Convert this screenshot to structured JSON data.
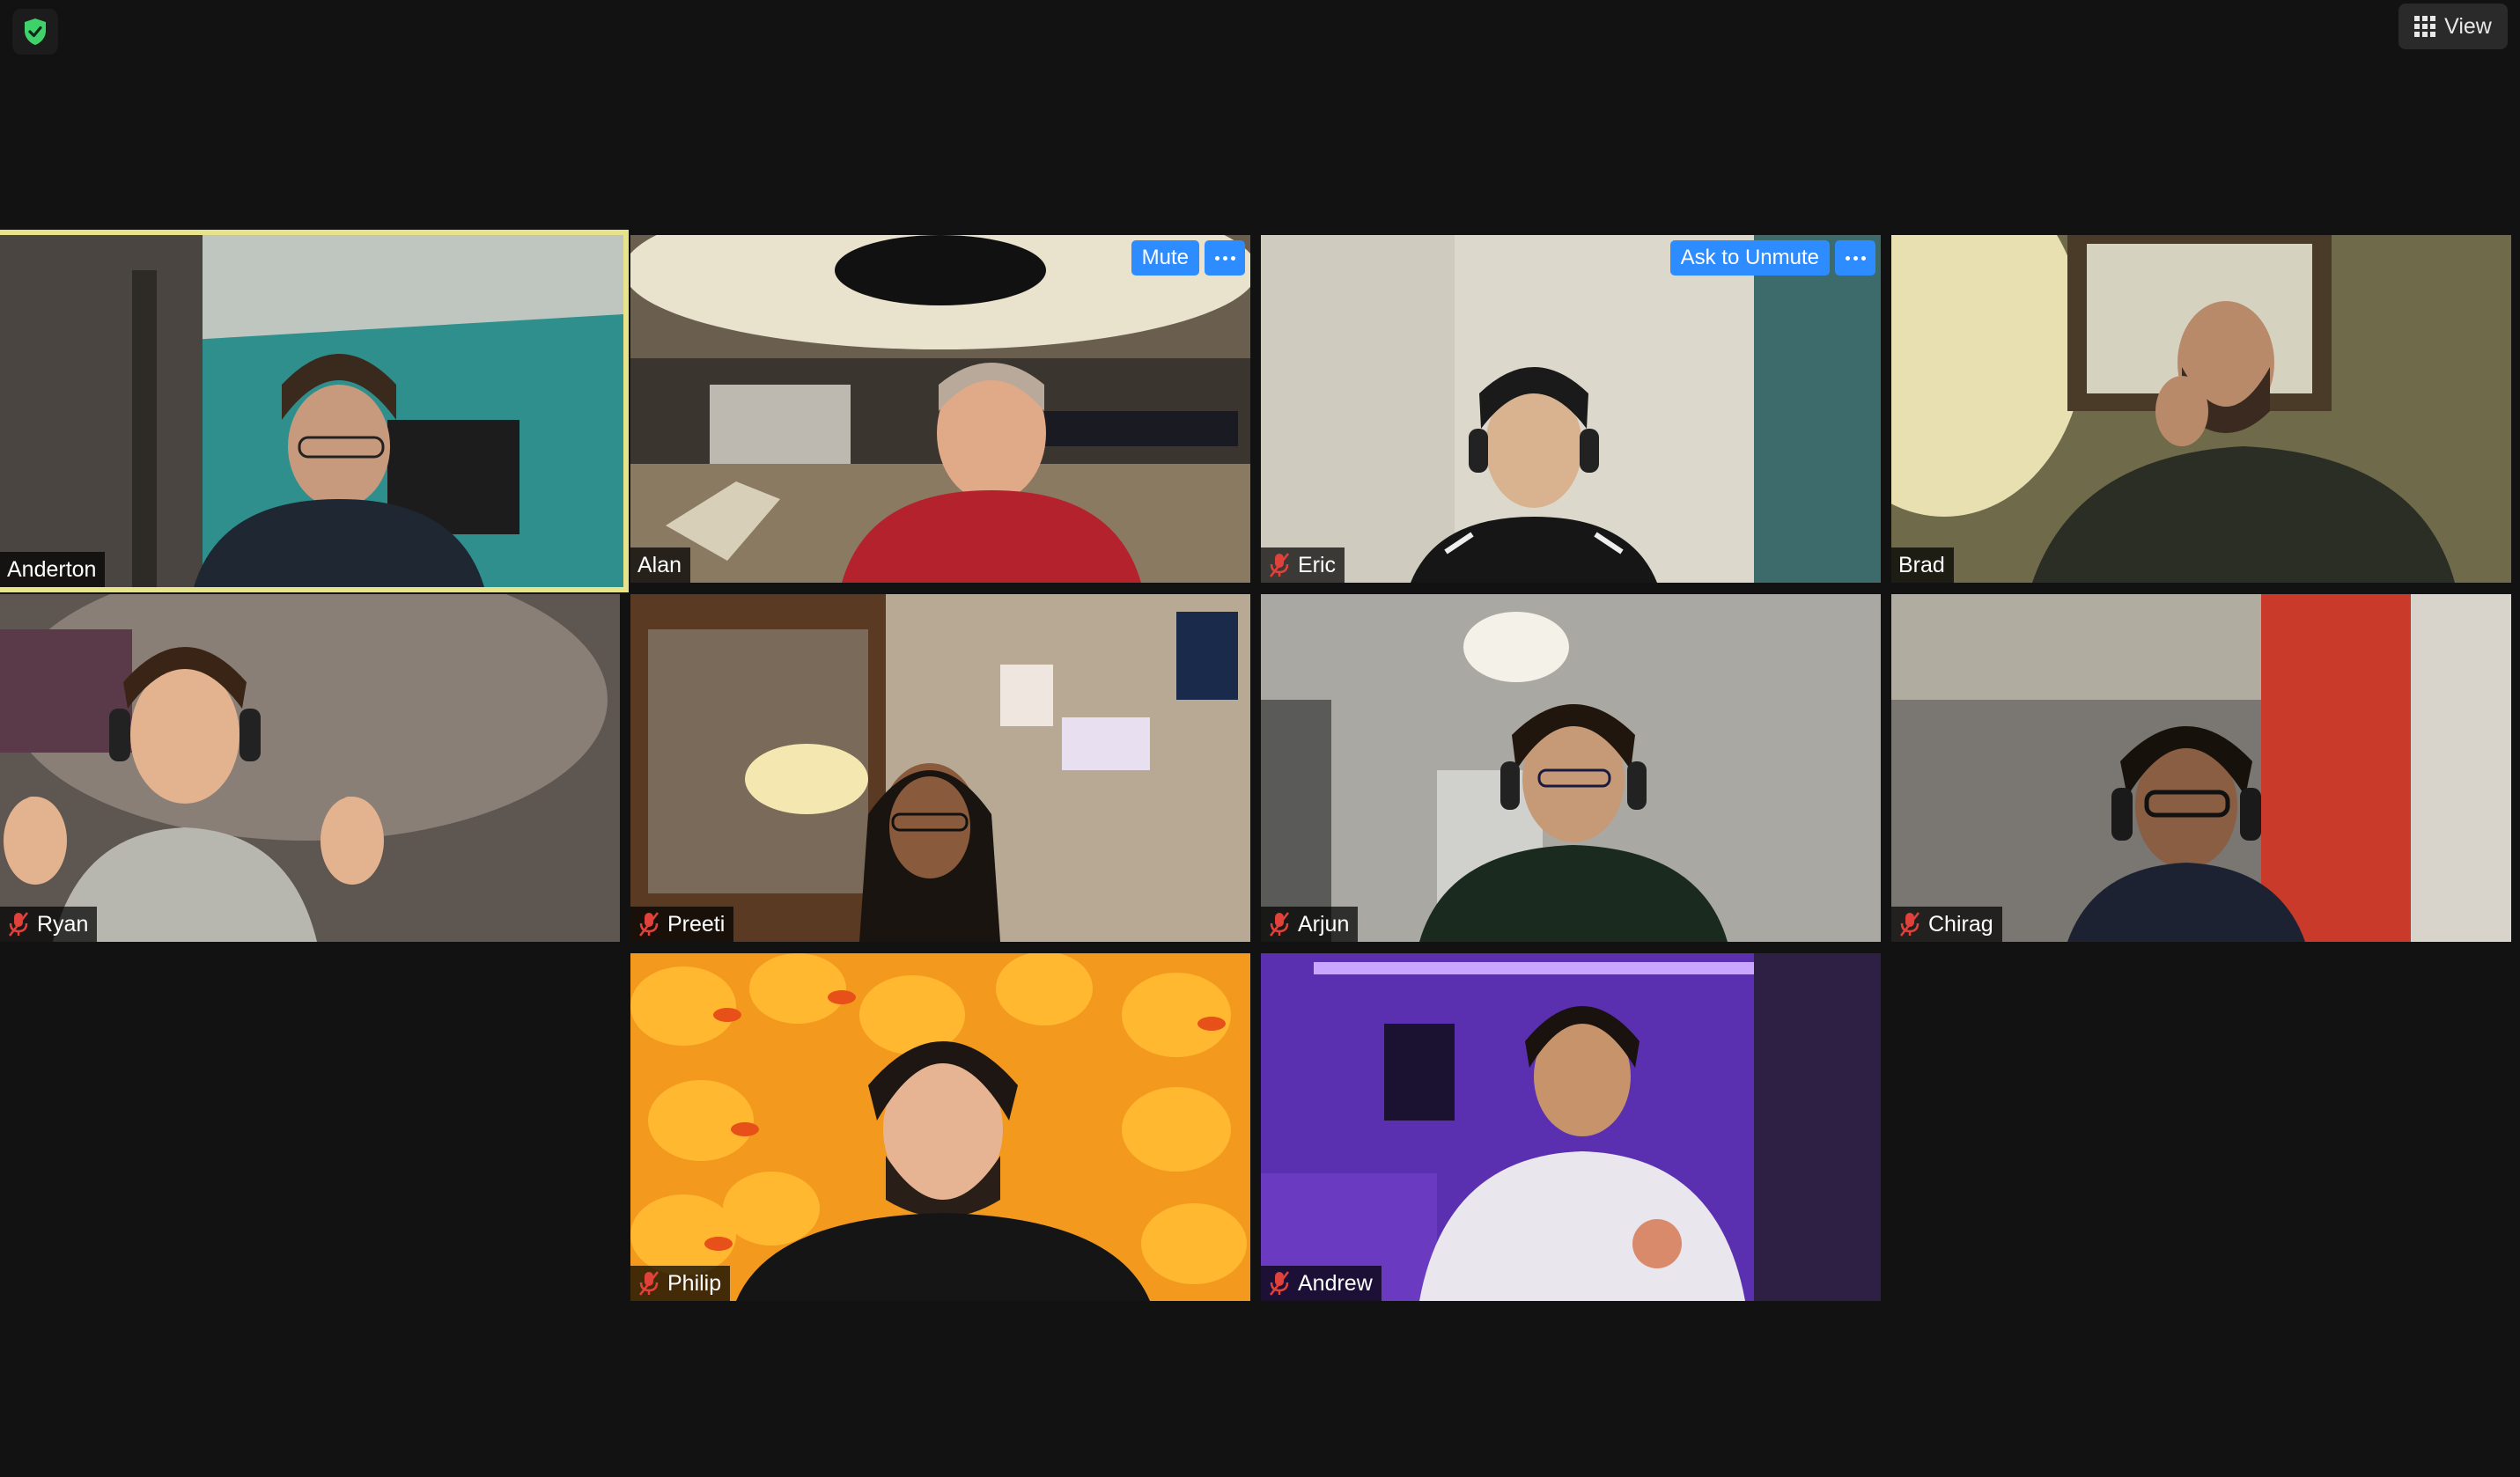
{
  "toolbar": {
    "view_label": "View",
    "shield_icon": "shield-check-icon",
    "shield_color": "#3fd16a"
  },
  "tile_controls": {
    "mute_label": "Mute",
    "ask_to_unmute_label": "Ask to Unmute"
  },
  "colors": {
    "active_speaker_border": "#e6e38a",
    "button_blue": "#2d8cff",
    "mic_off_red": "#e0413a"
  },
  "participants": [
    {
      "name": "Anderton",
      "muted": false,
      "active_speaker": true
    },
    {
      "name": "Alan",
      "muted": false
    },
    {
      "name": "Eric",
      "muted": true
    },
    {
      "name": "Brad",
      "muted": false
    },
    {
      "name": "Ryan",
      "muted": true
    },
    {
      "name": "Preeti",
      "muted": true
    },
    {
      "name": "Arjun",
      "muted": true
    },
    {
      "name": "Chirag",
      "muted": true
    },
    {
      "name": "Philip",
      "muted": true
    },
    {
      "name": "Andrew",
      "muted": true
    }
  ]
}
